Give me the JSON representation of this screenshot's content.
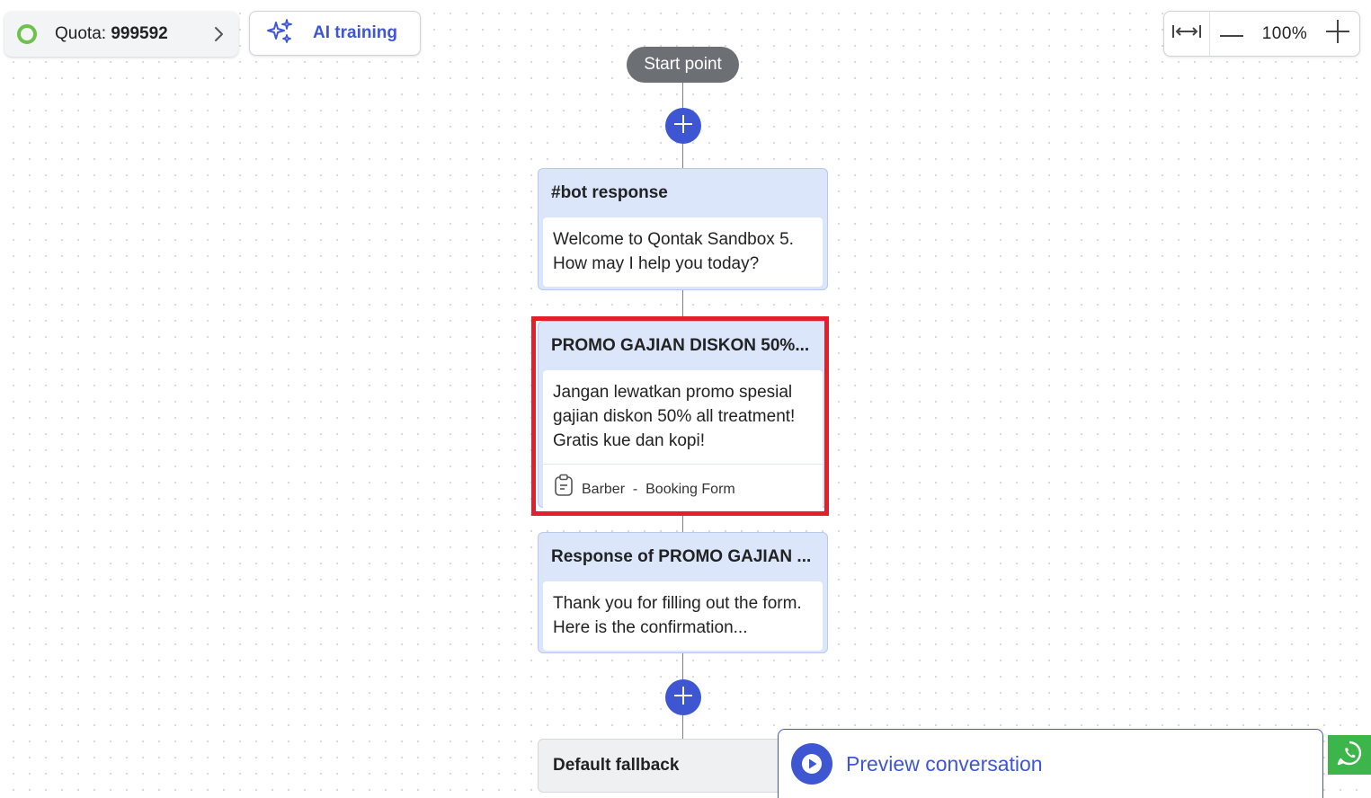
{
  "toolbar": {
    "quota_label": "Quota:",
    "quota_value": "999592",
    "ai_training_label": "AI training"
  },
  "zoom": {
    "level": "100%"
  },
  "flow": {
    "start_label": "Start point",
    "nodes": [
      {
        "title": "#bot response",
        "body": "Welcome to Qontak Sandbox 5. How may I help you today?"
      },
      {
        "title": "PROMO GAJIAN DISKON 50%...",
        "body": "Jangan lewatkan promo spesial gajian diskon 50% all treatment! Gratis kue dan kopi!",
        "form_label": "Barber  -  Booking Form"
      },
      {
        "title": "Response of PROMO GAJIAN ...",
        "body": "Thank you for filling out the form. Here is the confirmation..."
      }
    ],
    "fallback_label": "Default fallback"
  },
  "preview": {
    "label": "Preview conversation"
  },
  "colors": {
    "accent": "#3f56d3",
    "highlight": "#e3202a",
    "quota_ring": "#6cc24a",
    "whatsapp": "#3cb54a"
  }
}
